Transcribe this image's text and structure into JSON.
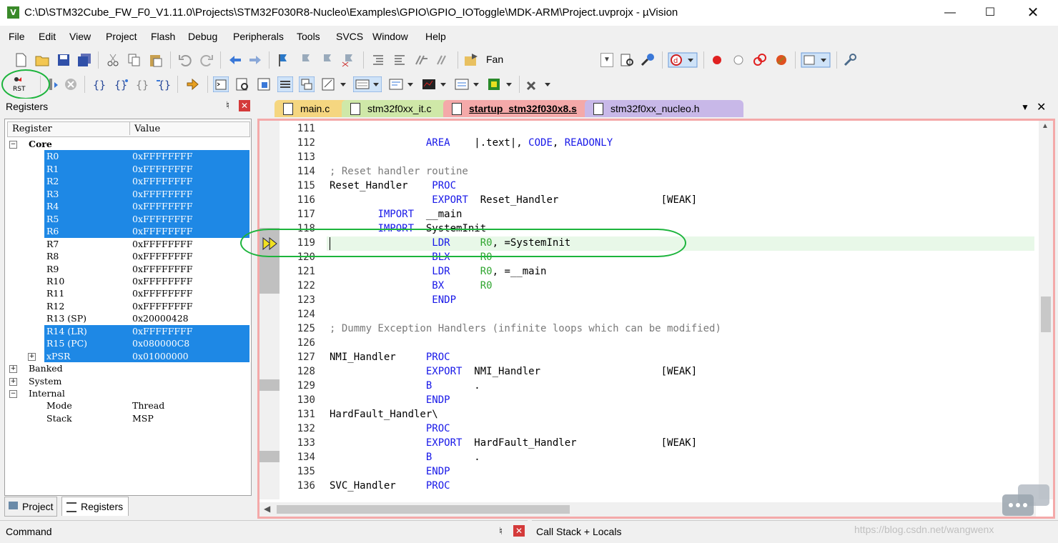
{
  "window": {
    "title": "C:\\D\\STM32Cube_FW_F0_V1.11.0\\Projects\\STM32F030R8-Nucleo\\Examples\\GPIO\\GPIO_IOToggle\\MDK-ARM\\Project.uvprojx - µVision",
    "app_icon": "V"
  },
  "menu": [
    "File",
    "Edit",
    "View",
    "Project",
    "Flash",
    "Debug",
    "Peripherals",
    "Tools",
    "SVCS",
    "Window",
    "Help"
  ],
  "toolbar": {
    "target_combo": "Fan",
    "rst_label": "RST"
  },
  "registers_panel": {
    "title": "Registers",
    "col_register": "Register",
    "col_value": "Value",
    "rows": [
      {
        "name": "Core",
        "value": "",
        "level": 0,
        "exp": "−",
        "bold": true,
        "sel": false
      },
      {
        "name": "R0",
        "value": "0xFFFFFFFF",
        "level": 2,
        "exp": "",
        "sel": true
      },
      {
        "name": "R1",
        "value": "0xFFFFFFFF",
        "level": 2,
        "exp": "",
        "sel": true
      },
      {
        "name": "R2",
        "value": "0xFFFFFFFF",
        "level": 2,
        "exp": "",
        "sel": true
      },
      {
        "name": "R3",
        "value": "0xFFFFFFFF",
        "level": 2,
        "exp": "",
        "sel": true
      },
      {
        "name": "R4",
        "value": "0xFFFFFFFF",
        "level": 2,
        "exp": "",
        "sel": true
      },
      {
        "name": "R5",
        "value": "0xFFFFFFFF",
        "level": 2,
        "exp": "",
        "sel": true
      },
      {
        "name": "R6",
        "value": "0xFFFFFFFF",
        "level": 2,
        "exp": "",
        "sel": true
      },
      {
        "name": "R7",
        "value": "0xFFFFFFFF",
        "level": 2,
        "exp": "",
        "sel": false
      },
      {
        "name": "R8",
        "value": "0xFFFFFFFF",
        "level": 2,
        "exp": "",
        "sel": false
      },
      {
        "name": "R9",
        "value": "0xFFFFFFFF",
        "level": 2,
        "exp": "",
        "sel": false
      },
      {
        "name": "R10",
        "value": "0xFFFFFFFF",
        "level": 2,
        "exp": "",
        "sel": false
      },
      {
        "name": "R11",
        "value": "0xFFFFFFFF",
        "level": 2,
        "exp": "",
        "sel": false
      },
      {
        "name": "R12",
        "value": "0xFFFFFFFF",
        "level": 2,
        "exp": "",
        "sel": false
      },
      {
        "name": "R13 (SP)",
        "value": "0x20000428",
        "level": 2,
        "exp": "",
        "sel": false
      },
      {
        "name": "R14 (LR)",
        "value": "0xFFFFFFFF",
        "level": 2,
        "exp": "",
        "sel": true
      },
      {
        "name": "R15 (PC)",
        "value": "0x080000C8",
        "level": 2,
        "exp": "",
        "sel": true
      },
      {
        "name": "xPSR",
        "value": "0x01000000",
        "level": 2,
        "exp": "+",
        "sel": true
      },
      {
        "name": "Banked",
        "value": "",
        "level": 0,
        "exp": "+",
        "sel": false
      },
      {
        "name": "System",
        "value": "",
        "level": 0,
        "exp": "+",
        "sel": false
      },
      {
        "name": "Internal",
        "value": "",
        "level": 0,
        "exp": "−",
        "sel": false
      },
      {
        "name": "Mode",
        "value": "Thread",
        "level": 2,
        "exp": "",
        "sel": false
      },
      {
        "name": "Stack",
        "value": "MSP",
        "level": 2,
        "exp": "",
        "sel": false
      }
    ],
    "tabs": [
      "Project",
      "Registers"
    ]
  },
  "editor": {
    "tabs": [
      {
        "label": "main.c",
        "color": "#f5d680"
      },
      {
        "label": "stm32f0xx_it.c",
        "color": "#cfe8a8"
      },
      {
        "label": "startup_stm32f030x8.s",
        "color": "#f4a9a9"
      },
      {
        "label": "stm32f0xx_nucleo.h",
        "color": "#c8b8e8"
      }
    ],
    "current_line": 119,
    "lines": [
      {
        "n": "111",
        "segs": []
      },
      {
        "n": "112",
        "segs": [
          [
            "",
            "                "
          ],
          [
            "kw",
            "AREA"
          ],
          [
            "",
            "    |.text|, "
          ],
          [
            "kw",
            "CODE"
          ],
          [
            "",
            ", "
          ],
          [
            "kw",
            "READONLY"
          ]
        ]
      },
      {
        "n": "113",
        "segs": []
      },
      {
        "n": "114",
        "segs": [
          [
            "cm",
            "; Reset handler routine"
          ]
        ]
      },
      {
        "n": "115",
        "segs": [
          [
            "",
            "Reset_Handler    "
          ],
          [
            "kw",
            "PROC"
          ]
        ]
      },
      {
        "n": "116",
        "segs": [
          [
            "",
            "                 "
          ],
          [
            "kw",
            "EXPORT"
          ],
          [
            "",
            "  Reset_Handler                 [WEAK]"
          ]
        ]
      },
      {
        "n": "117",
        "segs": [
          [
            "",
            "        "
          ],
          [
            "kw",
            "IMPORT"
          ],
          [
            "",
            "  __main"
          ]
        ]
      },
      {
        "n": "118",
        "segs": [
          [
            "",
            "        "
          ],
          [
            "kw",
            "IMPORT"
          ],
          [
            "",
            "  SystemInit"
          ]
        ]
      },
      {
        "n": "119",
        "segs": [
          [
            "",
            "                 "
          ],
          [
            "kw",
            "LDR"
          ],
          [
            "",
            "     "
          ],
          [
            "reg",
            "R0"
          ],
          [
            "",
            ", =SystemInit"
          ]
        ]
      },
      {
        "n": "120",
        "segs": [
          [
            "",
            "                 "
          ],
          [
            "kw",
            "BLX"
          ],
          [
            "",
            "     "
          ],
          [
            "reg",
            "R0"
          ]
        ]
      },
      {
        "n": "121",
        "segs": [
          [
            "",
            "                 "
          ],
          [
            "kw",
            "LDR"
          ],
          [
            "",
            "     "
          ],
          [
            "reg",
            "R0"
          ],
          [
            "",
            ", =__main"
          ]
        ]
      },
      {
        "n": "122",
        "segs": [
          [
            "",
            "                 "
          ],
          [
            "kw",
            "BX"
          ],
          [
            "",
            "      "
          ],
          [
            "reg",
            "R0"
          ]
        ]
      },
      {
        "n": "123",
        "segs": [
          [
            "",
            "                 "
          ],
          [
            "kw",
            "ENDP"
          ]
        ]
      },
      {
        "n": "124",
        "segs": []
      },
      {
        "n": "125",
        "segs": [
          [
            "cm",
            "; Dummy Exception Handlers (infinite loops which can be modified)"
          ]
        ]
      },
      {
        "n": "126",
        "segs": []
      },
      {
        "n": "127",
        "segs": [
          [
            "",
            "NMI_Handler     "
          ],
          [
            "kw",
            "PROC"
          ]
        ]
      },
      {
        "n": "128",
        "segs": [
          [
            "",
            "                "
          ],
          [
            "kw",
            "EXPORT"
          ],
          [
            "",
            "  NMI_Handler                    [WEAK]"
          ]
        ]
      },
      {
        "n": "129",
        "segs": [
          [
            "",
            "                "
          ],
          [
            "kw",
            "B"
          ],
          [
            "",
            "       ."
          ]
        ]
      },
      {
        "n": "130",
        "segs": [
          [
            "",
            "                "
          ],
          [
            "kw",
            "ENDP"
          ]
        ]
      },
      {
        "n": "131",
        "segs": [
          [
            "",
            "HardFault_Handler\\"
          ]
        ]
      },
      {
        "n": "132",
        "segs": [
          [
            "",
            "                "
          ],
          [
            "kw",
            "PROC"
          ]
        ]
      },
      {
        "n": "133",
        "segs": [
          [
            "",
            "                "
          ],
          [
            "kw",
            "EXPORT"
          ],
          [
            "",
            "  HardFault_Handler              [WEAK]"
          ]
        ]
      },
      {
        "n": "134",
        "segs": [
          [
            "",
            "                "
          ],
          [
            "kw",
            "B"
          ],
          [
            "",
            "       ."
          ]
        ]
      },
      {
        "n": "135",
        "segs": [
          [
            "",
            "                "
          ],
          [
            "kw",
            "ENDP"
          ]
        ]
      },
      {
        "n": "136",
        "segs": [
          [
            "",
            "SVC_Handler     "
          ],
          [
            "kw",
            "PROC"
          ]
        ]
      }
    ]
  },
  "status": {
    "command_label": "Command",
    "callstack_label": "Call Stack + Locals",
    "watermark": "https://blog.csdn.net/wangwenx"
  }
}
